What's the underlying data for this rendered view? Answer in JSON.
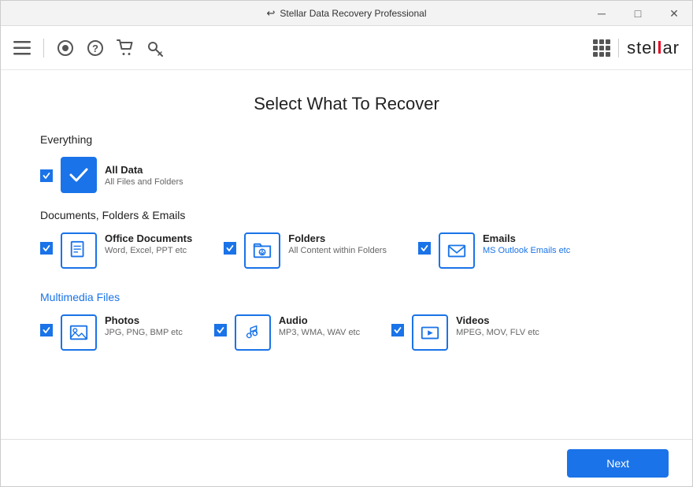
{
  "titleBar": {
    "title": "Stellar Data Recovery Professional",
    "backIcon": "↩",
    "minimizeLabel": "─",
    "restoreLabel": "□",
    "closeLabel": "✕"
  },
  "toolbar": {
    "menuIcon": "☰",
    "historyIcon": "◎",
    "helpIcon": "?",
    "cartIcon": "🛒",
    "keyIcon": "🔑"
  },
  "pageTitle": "Select What To Recover",
  "sections": {
    "everything": {
      "label": "Everything",
      "items": [
        {
          "name": "All Data",
          "desc": "All Files and Folders"
        }
      ]
    },
    "documents": {
      "label": "Documents, Folders & Emails",
      "items": [
        {
          "name": "Office Documents",
          "desc": "Word, Excel, PPT etc"
        },
        {
          "name": "Folders",
          "desc": "All Content within Folders"
        },
        {
          "name": "Emails",
          "desc": "MS Outlook Emails etc"
        }
      ]
    },
    "multimedia": {
      "label": "Multimedia Files",
      "items": [
        {
          "name": "Photos",
          "desc": "JPG, PNG, BMP etc"
        },
        {
          "name": "Audio",
          "desc": "MP3, WMA, WAV etc"
        },
        {
          "name": "Videos",
          "desc": "MPEG, MOV, FLV etc"
        }
      ]
    }
  },
  "footer": {
    "nextButton": "Next"
  },
  "stellarLogo": "stellar"
}
